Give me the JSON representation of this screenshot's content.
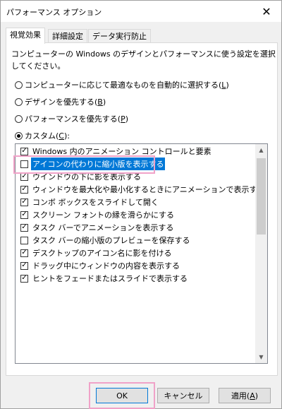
{
  "window": {
    "title": "パフォーマンス オプション",
    "close_glyph": "✕"
  },
  "tabs": [
    {
      "label": "視覚効果"
    },
    {
      "label": "詳細設定"
    },
    {
      "label": "データ実行防止"
    }
  ],
  "description": "コンピューターの Windows のデザインとパフォーマンスに使う設定を選択してください。",
  "radios": [
    {
      "label": "コンピューターに応じて最適なものを自動的に選択する(",
      "key": "L",
      "suffix": ")",
      "checked": false
    },
    {
      "label": "デザインを優先する(",
      "key": "B",
      "suffix": ")",
      "checked": false
    },
    {
      "label": "パフォーマンスを優先する(",
      "key": "P",
      "suffix": ")",
      "checked": false
    },
    {
      "label": "カスタム(",
      "key": "C",
      "suffix": "):",
      "checked": true
    }
  ],
  "list_items": [
    {
      "label": "Windows 内のアニメーション コントロールと要素",
      "checked": true
    },
    {
      "label": "アイコンの代わりに縮小版を表示する",
      "checked": false,
      "selected": true
    },
    {
      "label": "ウインドウの下に影を表示する",
      "checked": true
    },
    {
      "label": "ウィンドウを最大化や最小化するときにアニメーションで表示する",
      "checked": true
    },
    {
      "label": "コンボ ボックスをスライドして開く",
      "checked": true
    },
    {
      "label": "スクリーン フォントの縁を滑らかにする",
      "checked": true
    },
    {
      "label": "タスク バーでアニメーションを表示する",
      "checked": true
    },
    {
      "label": "タスク バーの縮小版のプレビューを保存する",
      "checked": false
    },
    {
      "label": "デスクトップのアイコン名に影を付ける",
      "checked": true
    },
    {
      "label": "ドラッグ中にウィンドウの内容を表示する",
      "checked": true
    },
    {
      "label": "ヒントをフェードまたはスライドで表示する",
      "checked": true
    }
  ],
  "buttons": {
    "ok": "OK",
    "cancel": "キャンセル",
    "apply": "適用(",
    "apply_key": "A",
    "apply_suffix": ")"
  },
  "check_glyph": "✓",
  "highlight_color": "#f0a2c8",
  "selection_color": "#0078d7"
}
